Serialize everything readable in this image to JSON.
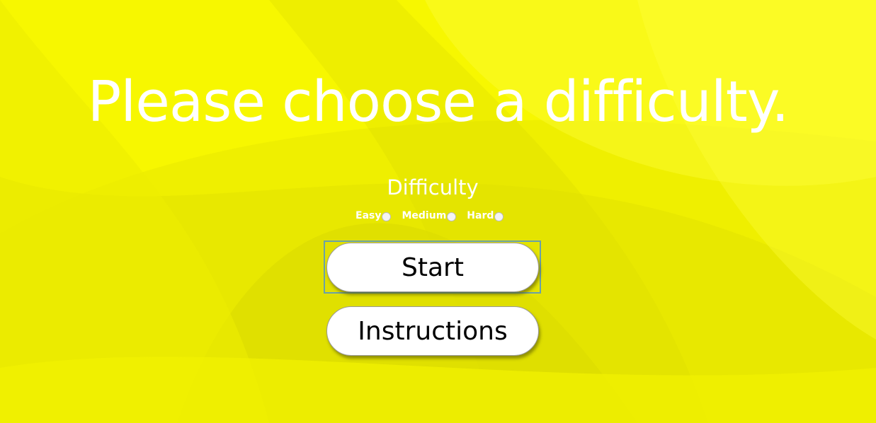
{
  "heading": "Please choose a difficulty.",
  "difficulty": {
    "label": "Difficulty",
    "options": [
      {
        "label": "Easy",
        "selected": false
      },
      {
        "label": "Medium",
        "selected": false
      },
      {
        "label": "Hard",
        "selected": false
      }
    ]
  },
  "buttons": {
    "start": "Start",
    "instructions": "Instructions",
    "focused": "start"
  },
  "colors": {
    "background": "#f7f700",
    "text": "#ffffff",
    "button_bg": "#ffffff",
    "button_text": "#000000",
    "focus_ring": "#6aa1a9"
  }
}
